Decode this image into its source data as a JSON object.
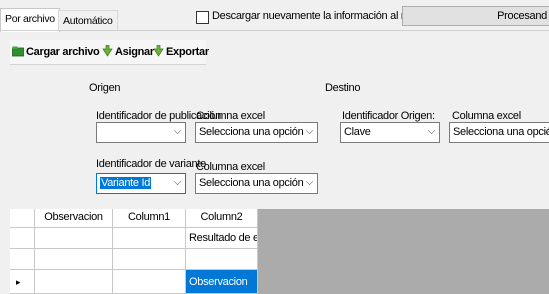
{
  "tabs": [
    {
      "label": "Por archivo",
      "active": true
    },
    {
      "label": "Automático",
      "active": false
    }
  ],
  "reload_checkbox": {
    "label": "Descargar nuevamente la información al relacionar",
    "checked": false
  },
  "process_button": {
    "label": "Procesand"
  },
  "toolbar": {
    "load_file": "Cargar archivo",
    "assign": "Asignar",
    "export": "Exportar"
  },
  "origin": {
    "heading": "Origen",
    "pub_id_label": "Identificador de publicación",
    "pub_id_value": "",
    "pub_excel_label": "Columna excel",
    "pub_excel_value": "Selecciona una opción",
    "variant_id_label": "Identificador de variante",
    "variant_id_value": "Variante Id",
    "variant_excel_label": "Columna excel",
    "variant_excel_value": "Selecciona una opción"
  },
  "destination": {
    "heading": "Destino",
    "origin_id_label": "Identificador Origen:",
    "origin_id_value": "Clave",
    "excel_label": "Columna excel",
    "excel_value": "Selecciona una opción"
  },
  "grid": {
    "columns": [
      "Observacion",
      "Column1",
      "Column2"
    ],
    "rows": [
      {
        "marker": "",
        "cells": [
          "",
          "",
          "Resultado de enl..."
        ]
      },
      {
        "marker": "",
        "cells": [
          "",
          "",
          ""
        ]
      },
      {
        "marker": "▸",
        "cells": [
          "",
          "",
          "Observacion"
        ]
      }
    ]
  },
  "colors": {
    "accent": "#0078d7",
    "grid_background": "#ababab"
  }
}
